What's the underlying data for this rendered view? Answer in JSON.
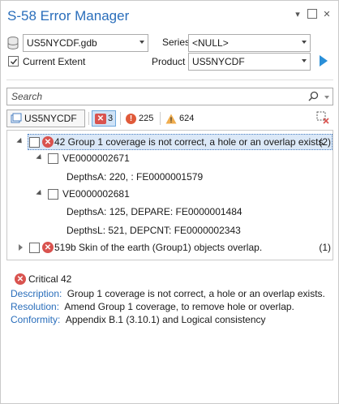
{
  "pane": {
    "title": "S-58 Error Manager"
  },
  "source": {
    "database": "US5NYCDF.gdb",
    "series_label": "Series",
    "series_value": "<NULL>",
    "current_extent_label": "Current Extent",
    "current_extent_checked": true,
    "product_label": "Product",
    "product_value": "US5NYCDF"
  },
  "search": {
    "placeholder": "Search"
  },
  "toolbar": {
    "product_button": "US5NYCDF",
    "critical_count": "3",
    "error_count": "225",
    "warning_count": "624"
  },
  "tree": {
    "items": [
      {
        "text": "42 Group 1 coverage is not correct, a hole or an overlap exists.",
        "count": "(2)"
      },
      {
        "text": "VE0000002671"
      },
      {
        "text": "DepthsA: 220, : FE0000001579"
      },
      {
        "text": "VE0000002681"
      },
      {
        "text": "DepthsA: 125, DEPARE: FE0000001484"
      },
      {
        "text": "DepthsL: 521, DEPCNT: FE0000002343"
      },
      {
        "text": "519b Skin of the earth (Group1) objects overlap.",
        "count": "(1)"
      }
    ]
  },
  "details": {
    "heading": "Critical 42",
    "description_label": "Description:",
    "description": "Group 1 coverage is not correct, a hole or an overlap exists.",
    "resolution_label": "Resolution:",
    "resolution": "Amend Group 1 coverage, to remove hole or overlap.",
    "conformity_label": "Conformity:",
    "conformity": "Appendix B.1 (3.10.1) and Logical consistency"
  },
  "colors": {
    "accent": "#2a6ebb",
    "critical": "#d9534f",
    "error": "#e05a3a",
    "warning": "#f0ad4e",
    "selected_row": "#dbe8f7"
  }
}
